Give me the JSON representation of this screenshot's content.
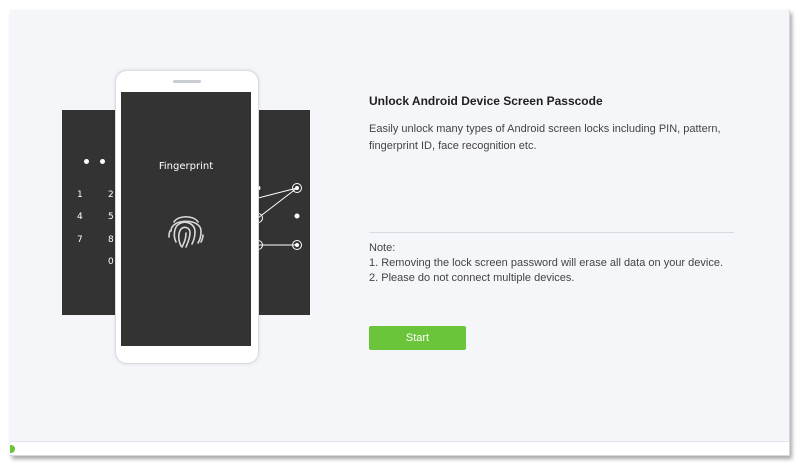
{
  "illustration": {
    "fingerprint_label": "Fingerprint",
    "pin_pad": {
      "row1": [
        "1",
        "2"
      ],
      "row2": [
        "4",
        "5"
      ],
      "row3": [
        "7",
        "8"
      ],
      "row4": [
        "0"
      ]
    }
  },
  "content": {
    "title": "Unlock Android Device Screen Passcode",
    "description": "Easily unlock many types of Android screen locks including PIN, pattern, fingerprint ID, face recognition etc.",
    "note_heading": "Note:",
    "note_items": [
      "1. Removing the lock screen password will erase all data on your device.",
      "2. Please do not connect multiple devices."
    ],
    "start_label": "Start"
  },
  "colors": {
    "accent_green": "#6ac53a",
    "panel_dark": "#333333",
    "background": "#f5f6fa"
  }
}
